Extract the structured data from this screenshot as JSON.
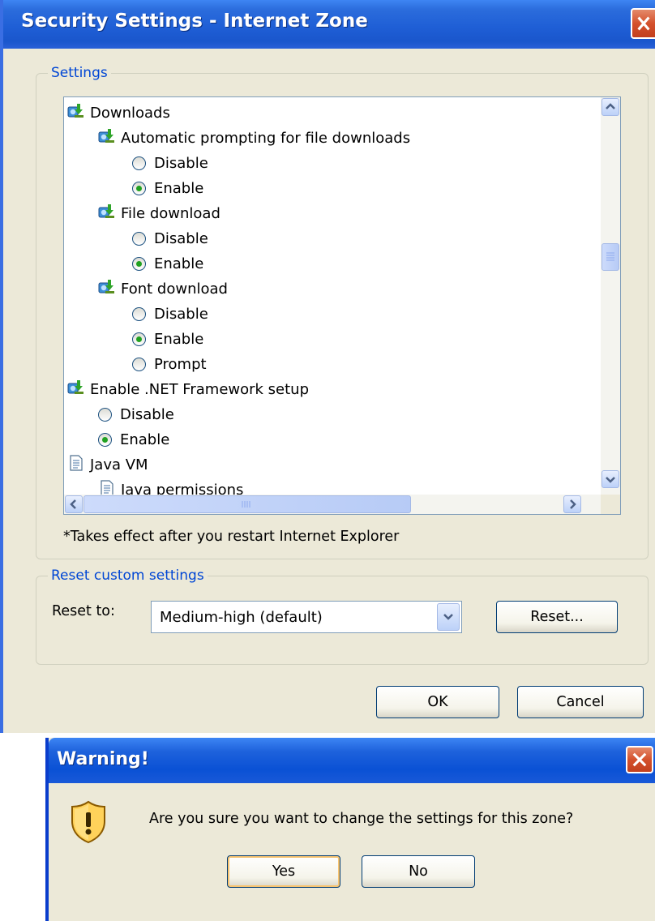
{
  "main_dialog": {
    "title": "Security Settings - Internet Zone",
    "settings_group_label": "Settings",
    "tree_items": [
      {
        "type": "folder",
        "label": "Downloads"
      },
      {
        "type": "setting",
        "label": "Automatic prompting for file downloads"
      },
      {
        "type": "option",
        "label": "Disable",
        "checked": false
      },
      {
        "type": "option",
        "label": "Enable",
        "checked": true
      },
      {
        "type": "setting",
        "label": "File download"
      },
      {
        "type": "option",
        "label": "Disable",
        "checked": false
      },
      {
        "type": "option",
        "label": "Enable",
        "checked": true
      },
      {
        "type": "setting",
        "label": "Font download"
      },
      {
        "type": "option",
        "label": "Disable",
        "checked": false
      },
      {
        "type": "option",
        "label": "Enable",
        "checked": true
      },
      {
        "type": "option",
        "label": "Prompt",
        "checked": false
      },
      {
        "type": "folder",
        "label": "Enable .NET Framework setup"
      },
      {
        "type": "option",
        "label": "Disable",
        "checked": false
      },
      {
        "type": "option",
        "label": "Enable",
        "checked": true
      },
      {
        "type": "folder",
        "label": "Java VM"
      },
      {
        "type": "setting",
        "label": "Java permissions"
      }
    ],
    "restart_note": "*Takes effect after you restart Internet Explorer",
    "reset_group_label": "Reset custom settings",
    "reset_to_label": "Reset to:",
    "reset_level_value": "Medium-high (default)",
    "reset_button": "Reset...",
    "ok_button": "OK",
    "cancel_button": "Cancel"
  },
  "warning_dialog": {
    "title": "Warning!",
    "message": "Are you sure you want to change the settings for this zone?",
    "yes_button": "Yes",
    "no_button": "No"
  },
  "icons": {
    "title_close": "close-icon",
    "setting": "network-download-icon",
    "doc": "document-icon",
    "warning": "security-shield-icon"
  }
}
